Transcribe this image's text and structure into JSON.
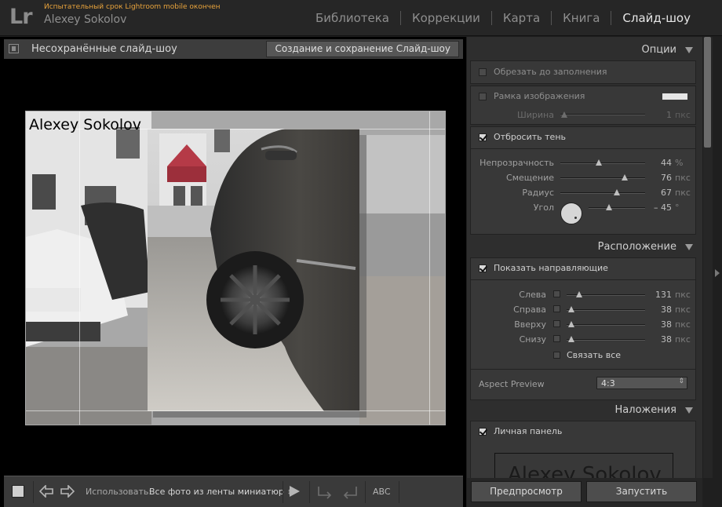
{
  "app": {
    "logo": "Lr",
    "trial_message": "Испытательный срок Lightroom mobile окончен",
    "user_name": "Alexey Sokolov"
  },
  "modules": [
    {
      "label": "Библиотека",
      "active": false
    },
    {
      "label": "Коррекции",
      "active": false
    },
    {
      "label": "Карта",
      "active": false
    },
    {
      "label": "Книга",
      "active": false
    },
    {
      "label": "Слайд-шоу",
      "active": true
    }
  ],
  "center": {
    "title": "Несохранённые слайд-шоу",
    "create_button": "Создание и сохранение Слайд-шоу",
    "slide_identity_text": "Alexey Sokolov"
  },
  "toolbar": {
    "use_label": "Использовать:",
    "use_value": "Все фото из ленты миниатюр",
    "abc_label": "ABC"
  },
  "options": {
    "title": "Опции",
    "zoom_to_fill": {
      "label": "Обрезать до заполнения",
      "checked": false
    },
    "stroke_border": {
      "label": "Рамка изображения",
      "checked": false,
      "color": "#e6e6e6"
    },
    "width": {
      "label": "Ширина",
      "value": "1",
      "unit": "пкс",
      "fraction": 0.0
    },
    "cast_shadow": {
      "label": "Отбросить тень",
      "checked": true
    },
    "opacity": {
      "label": "Непрозрачность",
      "value": "44",
      "unit": "%",
      "fraction": 0.44
    },
    "offset": {
      "label": "Смещение",
      "value": "76",
      "unit": "пкс",
      "fraction": 0.76
    },
    "radius": {
      "label": "Радиус",
      "value": "67",
      "unit": "пкс",
      "fraction": 0.67
    },
    "angle": {
      "label": "Угол",
      "value": "– 45",
      "unit": "°",
      "fraction": 0.5
    }
  },
  "layout": {
    "title": "Расположение",
    "show_guides": {
      "label": "Показать направляющие",
      "checked": true
    },
    "left": {
      "label": "Слева",
      "value": "131",
      "unit": "пкс",
      "checked": false,
      "fraction": 0.131
    },
    "right": {
      "label": "Справа",
      "value": "38",
      "unit": "пкс",
      "checked": false,
      "fraction": 0.038
    },
    "top": {
      "label": "Вверху",
      "value": "38",
      "unit": "пкс",
      "checked": false,
      "fraction": 0.038
    },
    "bottom": {
      "label": "Снизу",
      "value": "38",
      "unit": "пкс",
      "checked": false,
      "fraction": 0.038
    },
    "link_all": {
      "label": "Связать все",
      "checked": false
    },
    "aspect_preview": {
      "label": "Aspect Preview",
      "value": "4:3"
    }
  },
  "overlays": {
    "title": "Наложения",
    "identity_plate": {
      "label": "Личная панель",
      "checked": true,
      "preview_text": "Alexey Sokolov"
    }
  },
  "actions": {
    "preview": "Предпросмотр",
    "play": "Запустить"
  }
}
